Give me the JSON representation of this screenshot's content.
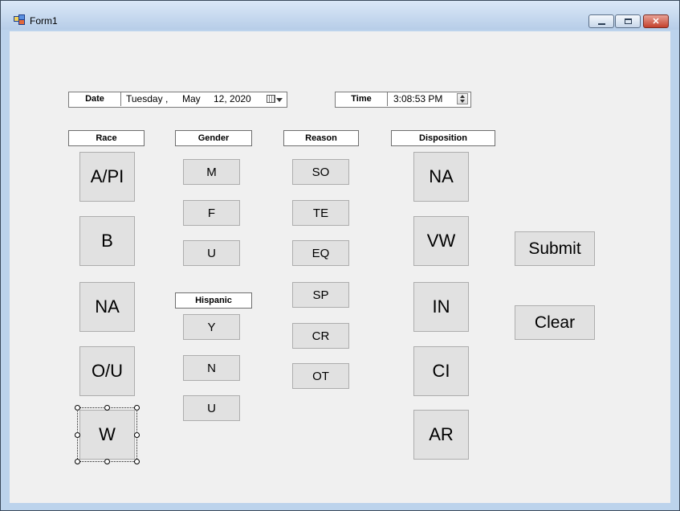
{
  "window": {
    "title": "Form1"
  },
  "datetime": {
    "date_label": "Date",
    "weekday": "Tuesday",
    "comma": ",",
    "month": "May",
    "day_year": "12, 2020",
    "time_label": "Time",
    "time_value": "3:08:53 PM"
  },
  "race": {
    "header": "Race",
    "buttons": [
      "A/PI",
      "B",
      "NA",
      "O/U",
      "W"
    ]
  },
  "gender": {
    "header": "Gender",
    "buttons": [
      "M",
      "F",
      "U"
    ]
  },
  "hispanic": {
    "header": "Hispanic",
    "buttons": [
      "Y",
      "N",
      "U"
    ]
  },
  "reason": {
    "header": "Reason",
    "buttons": [
      "SO",
      "TE",
      "EQ",
      "SP",
      "CR",
      "OT"
    ]
  },
  "disposition": {
    "header": "Disposition",
    "buttons": [
      "NA",
      "VW",
      "IN",
      "CI",
      "AR"
    ]
  },
  "actions": {
    "submit": "Submit",
    "clear": "Clear"
  },
  "icons": {
    "minimize": "minimize-icon",
    "maximize": "maximize-icon",
    "close": "close-icon",
    "calendar": "calendar-icon",
    "spin": "spin-updown-icon"
  }
}
